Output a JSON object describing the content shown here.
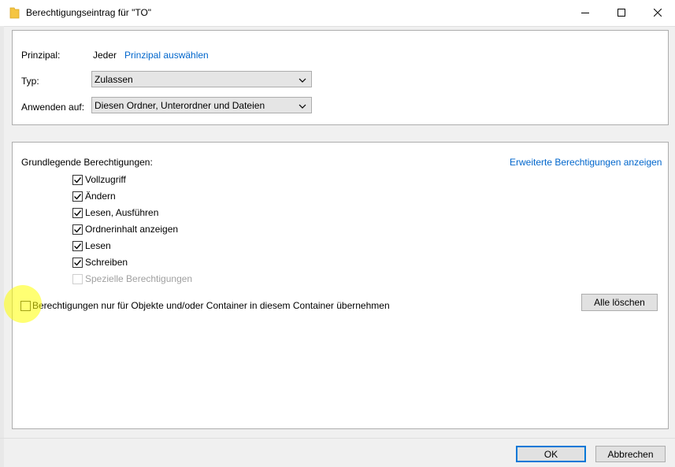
{
  "window": {
    "title": "Berechtigungseintrag für \"TO\"",
    "icon": "folder-icon",
    "controls": [
      "minimize-icon",
      "maximize-icon",
      "close-icon"
    ]
  },
  "principal": {
    "label": "Prinzipal:",
    "value": "Jeder",
    "select_link": "Prinzipal auswählen"
  },
  "type": {
    "label": "Typ:",
    "value": "Zulassen"
  },
  "apply_to": {
    "label": "Anwenden auf:",
    "value": "Diesen Ordner, Unterordner und Dateien"
  },
  "permissions": {
    "heading": "Grundlegende Berechtigungen:",
    "advanced_link": "Erweiterte Berechtigungen anzeigen",
    "items": [
      {
        "label": "Vollzugriff",
        "checked": true,
        "enabled": true
      },
      {
        "label": "Ändern",
        "checked": true,
        "enabled": true
      },
      {
        "label": "Lesen, Ausführen",
        "checked": true,
        "enabled": true
      },
      {
        "label": "Ordnerinhalt anzeigen",
        "checked": true,
        "enabled": true
      },
      {
        "label": "Lesen",
        "checked": true,
        "enabled": true
      },
      {
        "label": "Schreiben",
        "checked": true,
        "enabled": true
      },
      {
        "label": "Spezielle Berechtigungen",
        "checked": false,
        "enabled": false
      }
    ]
  },
  "inherit": {
    "label": "Berechtigungen nur für Objekte und/oder Container in diesem Container übernehmen",
    "checked": false
  },
  "buttons": {
    "clear_all": "Alle löschen",
    "ok": "OK",
    "cancel": "Abbrechen"
  },
  "colors": {
    "link": "#0066cc",
    "highlight": "#ffff00",
    "default_button_border": "#0078d7"
  }
}
